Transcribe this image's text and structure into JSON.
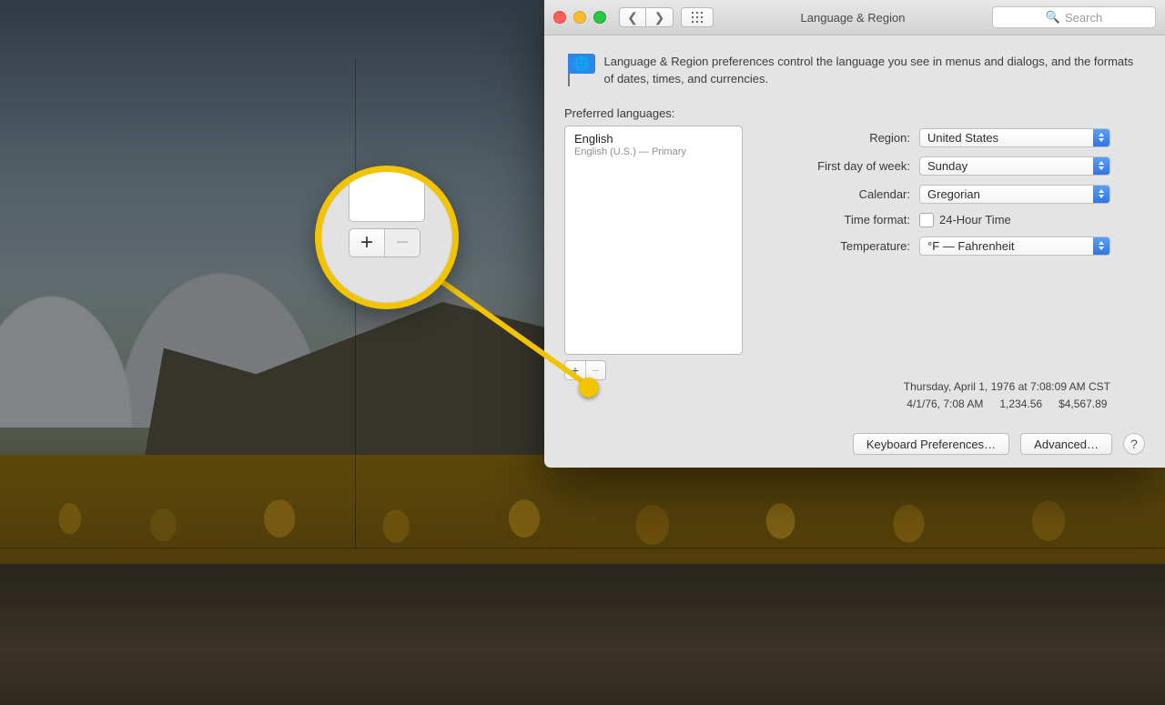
{
  "window": {
    "title": "Language & Region",
    "search_placeholder": "Search",
    "description": "Language & Region preferences control the language you see in menus and dialogs, and the formats of dates, times, and currencies."
  },
  "languages": {
    "section_label": "Preferred languages:",
    "items": [
      {
        "name": "English",
        "subtitle": "English (U.S.) — Primary"
      }
    ],
    "add_label": "+",
    "remove_label": "−"
  },
  "settings": {
    "region": {
      "label": "Region:",
      "value": "United States"
    },
    "first_day": {
      "label": "First day of week:",
      "value": "Sunday"
    },
    "calendar": {
      "label": "Calendar:",
      "value": "Gregorian"
    },
    "time_format": {
      "label": "Time format:",
      "checkbox_label": "24-Hour Time"
    },
    "temperature": {
      "label": "Temperature:",
      "value": "°F — Fahrenheit"
    }
  },
  "examples": {
    "long": "Thursday, April 1, 1976 at 7:08:09 AM CST",
    "short_date": "4/1/76, 7:08 AM",
    "number": "1,234.56",
    "currency": "$4,567.89"
  },
  "buttons": {
    "keyboard": "Keyboard Preferences…",
    "advanced": "Advanced…",
    "help": "?"
  },
  "magnifier": {
    "add_label": "+",
    "remove_label": "−"
  }
}
